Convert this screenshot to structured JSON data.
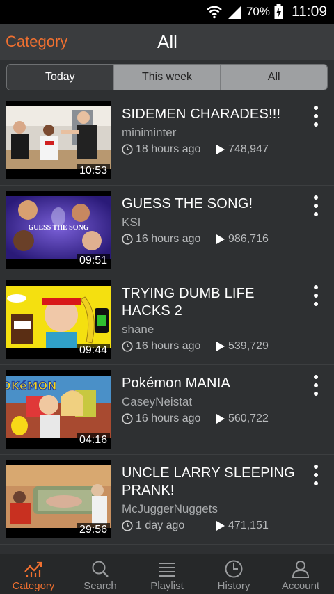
{
  "status_bar": {
    "battery": "70%",
    "time": "11:09"
  },
  "header": {
    "category": "Category",
    "title": "All"
  },
  "tabs": [
    {
      "label": "Today"
    },
    {
      "label": "This week"
    },
    {
      "label": "All"
    }
  ],
  "videos": [
    {
      "title": "SIDEMEN CHARADES!!!",
      "channel": "miniminter",
      "time": "18 hours ago",
      "views": "748,947",
      "duration": "10:53"
    },
    {
      "title": "GUESS THE SONG!",
      "channel": "KSI",
      "time": "16 hours ago",
      "views": "986,716",
      "duration": "09:51",
      "thumb_text": "GUESS THE SONG"
    },
    {
      "title": "TRYING DUMB LIFE HACKS 2",
      "channel": "shane",
      "time": "16 hours ago",
      "views": "539,729",
      "duration": "09:44"
    },
    {
      "title": "Pokémon MANIA",
      "channel": "CaseyNeistat",
      "time": "16 hours ago",
      "views": "560,722",
      "duration": "04:16",
      "thumb_text": "POKéMON"
    },
    {
      "title": "UNCLE LARRY SLEEPING PRANK!",
      "channel": "McJuggerNuggets",
      "time": "1 day ago",
      "views": "471,151",
      "duration": "29:56"
    }
  ],
  "bottom_nav": [
    {
      "label": "Category",
      "icon": "trending-chart-icon",
      "active": true
    },
    {
      "label": "Search",
      "icon": "search-icon"
    },
    {
      "label": "Playlist",
      "icon": "list-icon"
    },
    {
      "label": "History",
      "icon": "clock-icon"
    },
    {
      "label": "Account",
      "icon": "user-icon"
    }
  ],
  "colors": {
    "accent": "#f07030",
    "background": "#2e3032",
    "header": "#3a3c3e"
  }
}
